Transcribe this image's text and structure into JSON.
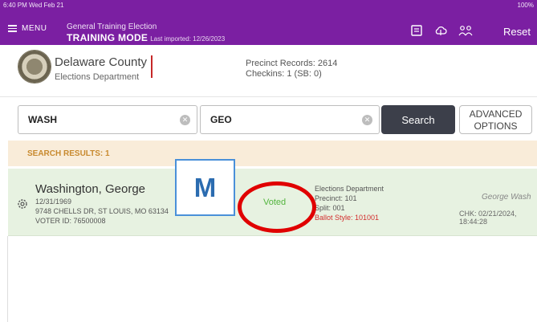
{
  "status_bar": {
    "time": "6:40 PM  Wed Feb 21",
    "battery": "100%"
  },
  "topbar": {
    "menu_label": "MENU",
    "title": "General Training Election",
    "mode": "TRAINING MODE",
    "last_imported": "Last imported: 12/26/2023",
    "reset_label": "Reset"
  },
  "header": {
    "org_name": "Delaware County",
    "org_sub": "Elections Department",
    "precinct_records": "Precinct Records: 2614",
    "checkins": "Checkins: 1 (SB: 0)"
  },
  "search": {
    "last_name": "WASH",
    "first_name": "GEO",
    "search_label": "Search",
    "advanced_line1": "ADVANCED",
    "advanced_line2": "OPTIONS"
  },
  "results": {
    "label": "SEARCH RESULTS: 1",
    "items": [
      {
        "name": "Washington, George",
        "dob": "12/31/1969",
        "address": "9748 CHELLS DR, ST LOUIS, MO 63134",
        "voter_id": "VOTER ID: 76500008",
        "status": "Voted",
        "location": "Elections Department",
        "precinct": "Precinct: 101",
        "split": "Split: 001",
        "ballot_style": "Ballot Style: 101001",
        "signature": "George Wash",
        "checkin": "CHK: 02/21/2024, 18:44:28"
      }
    ]
  },
  "annotation": {
    "marker": "M"
  },
  "colors": {
    "topbar": "#7b1fa2",
    "results_bar": "#f9ecd9",
    "row": "#e7f2e1",
    "voted": "#52b43d",
    "ring": "#e00000"
  }
}
